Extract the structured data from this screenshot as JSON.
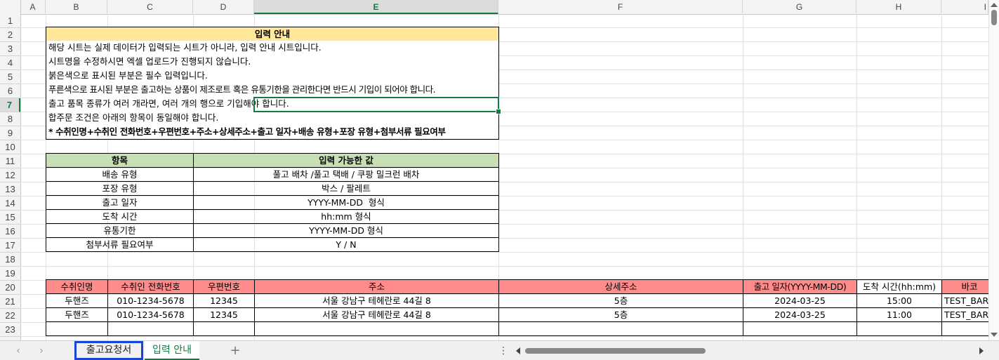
{
  "columns": [
    "A",
    "B",
    "C",
    "D",
    "E",
    "F",
    "G",
    "H",
    "I"
  ],
  "selected_column": "E",
  "rows": [
    "1",
    "2",
    "3",
    "4",
    "5",
    "6",
    "7",
    "8",
    "9",
    "10",
    "11",
    "12",
    "13",
    "14",
    "15",
    "16",
    "17",
    "18",
    "19",
    "20",
    "21",
    "22",
    "23"
  ],
  "selected_row": "7",
  "guide": {
    "title": "입력 안내",
    "lines": [
      "해당 시트는 실제 데이터가 입력되는 시트가 아니라, 입력 안내 시트입니다.",
      "시트명을 수정하시면 엑셀 업로드가 진행되지 않습니다.",
      "붉은색으로 표시된 부분은 필수 입력입니다.",
      "푸른색으로 표시된 부분은 출고하는 상품이 제조로트 혹은 유통기한을 관리한다면 반드시 기입이 되어야 합니다.",
      "출고 품목 종류가 여러 개라면, 여러 개의 행으로 기입해야 합니다.",
      "합주문 조건은 아래의 항목이 동일해야 합니다."
    ],
    "bold_line": "* 수취인명+수취인 전화번호+우편번호+주소+상세주소+출고 일자+배송 유형+포장 유형+첨부서류 필요여부"
  },
  "allowed": {
    "header_item": "항목",
    "header_values": "입력 가능한 값",
    "rows": [
      {
        "item": "배송 유형",
        "value": "풀고 배차 /풀고 택배 / 쿠팡 밀크런 배차"
      },
      {
        "item": "포장 유형",
        "value": "박스 / 팔레트"
      },
      {
        "item": "출고 일자",
        "value": "YYYY-MM-DD  형식"
      },
      {
        "item": "도착 시간",
        "value": "hh:mm 형식"
      },
      {
        "item": "유통기한",
        "value": "YYYY-MM-DD 형식"
      },
      {
        "item": "첨부서류 필요여부",
        "value": "Y / N"
      }
    ]
  },
  "sample": {
    "headers": [
      "수취인명",
      "수취인 전화번호",
      "우편번호",
      "주소",
      "상세주소",
      "출고 일자(YYYY-MM-DD)",
      "도착 시간(hh:mm)",
      "바코"
    ],
    "rows": [
      [
        "두핸즈",
        "010-1234-5678",
        "12345",
        "서울 강남구 테헤란로 44길 8",
        "5층",
        "2024-03-25",
        "15:00",
        "TEST_BAR"
      ],
      [
        "두핸즈",
        "010-1234-5678",
        "12345",
        "서울 강남구 테헤란로 44길 8",
        "5층",
        "2024-03-25",
        "11:00",
        "TEST_BAR"
      ]
    ]
  },
  "tabs": [
    {
      "label": "출고요청서",
      "highlighted": true
    },
    {
      "label": "입력 안내",
      "active": true
    }
  ],
  "colors": {
    "accent_green": "#107c41",
    "guide_title_fill": "#ffe699",
    "allowed_header_fill": "#c6e0b4",
    "required_header_fill": "#ff8b8b",
    "tab_highlight_border": "#1845d6"
  },
  "icons": {
    "prev_sheet": "chevron-left-icon",
    "next_sheet": "chevron-right-icon",
    "add_sheet": "plus-icon",
    "more": "vertical-ellipsis-icon"
  }
}
